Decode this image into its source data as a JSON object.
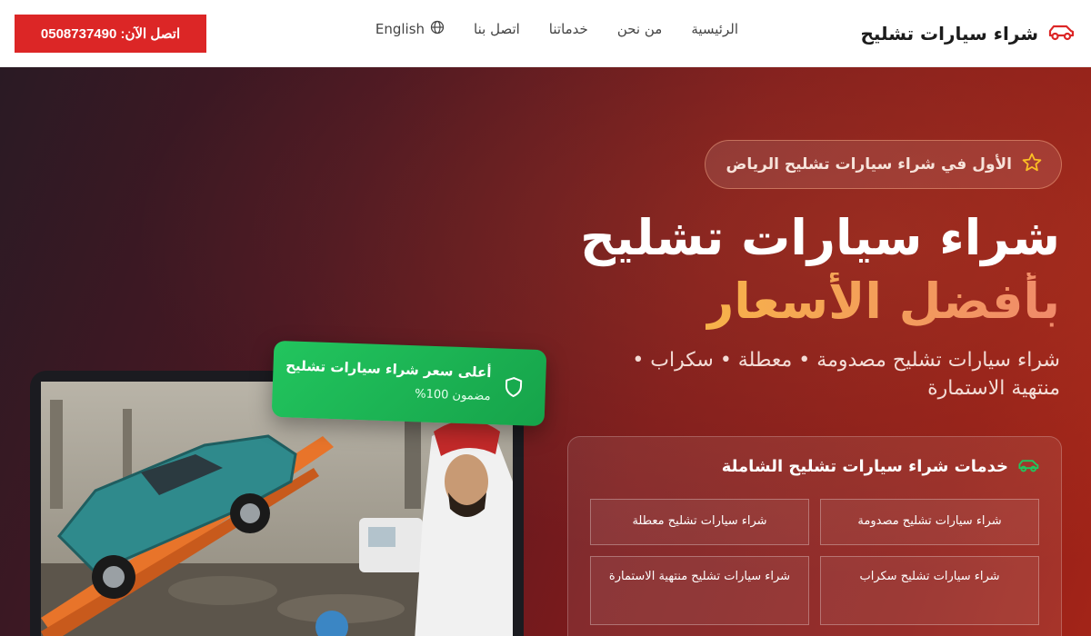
{
  "header": {
    "brand": "شراء سيارات تشليح",
    "brand_icon": "car-icon",
    "nav": [
      {
        "label": "الرئيسية"
      },
      {
        "label": "من نحن"
      },
      {
        "label": "خدماتنا"
      },
      {
        "label": "اتصل بنا"
      }
    ],
    "language": {
      "label": "English",
      "icon": "globe-icon"
    },
    "cta_label": "اتصل الآن: 0508737490"
  },
  "hero": {
    "badge": {
      "icon": "star-icon",
      "text": "الأول في شراء سيارات تشليح الرياض"
    },
    "title_line1": "شراء سيارات تشليح",
    "title_line2": "بأفضل الأسعار",
    "subtitle": "شراء سيارات تشليح مصدومة • معطلة • سكراب • منتهية الاستمارة",
    "services": {
      "icon": "car-icon",
      "title": "خدمات شراء سيارات تشليح الشاملة",
      "items": [
        "شراء سيارات تشليح مصدومة",
        "شراء سيارات تشليح معطلة",
        "شراء سيارات تشليح سكراب",
        "شراء سيارات تشليح منتهية الاستمارة"
      ]
    },
    "guarantee": {
      "icon": "shield-icon",
      "title": "أعلى سعر شراء سيارات تشليح",
      "subtitle": "مضمون 100%"
    }
  },
  "colors": {
    "accent_red": "#dc2626",
    "guarantee_green": "#22c55e",
    "title_gradient": [
      "#f7b24a",
      "#f08a6a"
    ]
  }
}
